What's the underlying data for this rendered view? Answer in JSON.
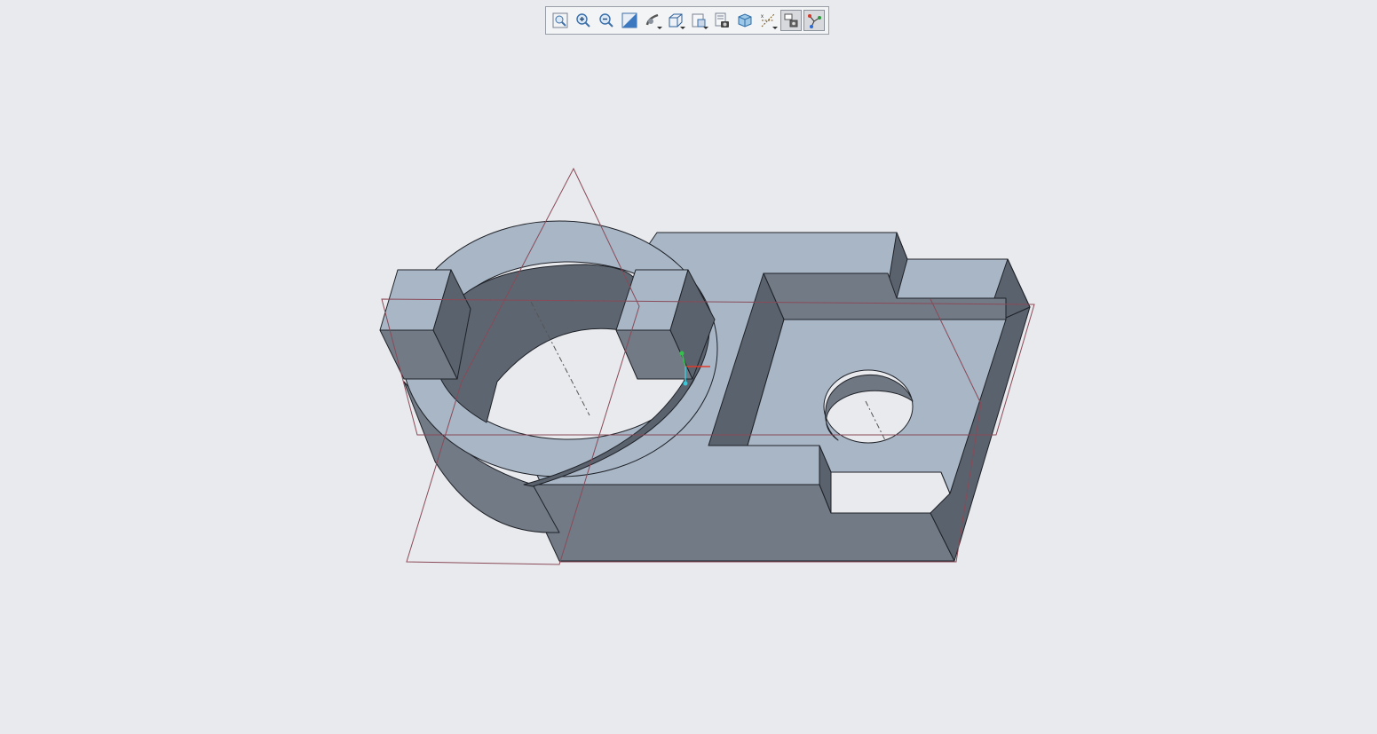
{
  "app": {
    "background": "#e9eaed"
  },
  "toolbar": {
    "buttons": [
      {
        "id": "refit",
        "icon": "refit-icon",
        "active": false
      },
      {
        "id": "zoom-in",
        "icon": "zoom-in-icon",
        "active": false
      },
      {
        "id": "zoom-out",
        "icon": "zoom-out-icon",
        "active": false
      },
      {
        "id": "repaint",
        "icon": "repaint-icon",
        "active": false
      },
      {
        "id": "reorient",
        "icon": "reorient-icon",
        "active": false,
        "flyout": true
      },
      {
        "id": "display-style",
        "icon": "display-style-icon",
        "active": false,
        "flyout": true
      },
      {
        "id": "saved-views",
        "icon": "saved-views-icon",
        "active": false,
        "flyout": true
      },
      {
        "id": "view-manager",
        "icon": "view-manager-icon",
        "active": false
      },
      {
        "id": "perspective",
        "icon": "perspective-view-icon",
        "active": false
      },
      {
        "id": "datum-display",
        "icon": "datum-display-icon",
        "active": false,
        "flyout": true
      },
      {
        "id": "annotation-display",
        "icon": "annotation-display-icon",
        "active": true
      },
      {
        "id": "spin-center",
        "icon": "spin-center-icon",
        "active": true
      }
    ]
  },
  "model": {
    "face_light": "#a8b6c6",
    "face_mid": "#727a86",
    "face_dark": "#5a626d",
    "edge": "#1f2228",
    "datum_plane": "#8a4a58",
    "axis": "#555555",
    "csys": {
      "x": "#e23a2a",
      "y": "#33c24a",
      "z": "#3ac7d8"
    }
  }
}
